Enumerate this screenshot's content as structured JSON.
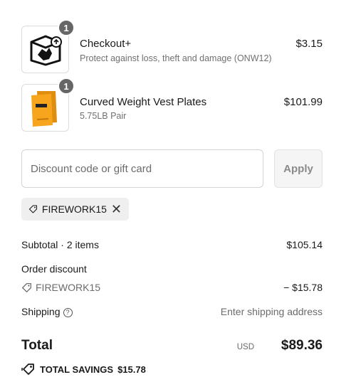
{
  "items": [
    {
      "name": "Checkout+",
      "subtitle": "Protect against loss, theft and damage (ONW12)",
      "price": "$3.15",
      "quantity": "1",
      "icon": "package-shield-icon"
    },
    {
      "name": "Curved Weight Vest Plates",
      "subtitle": "5.75LB Pair",
      "price": "$101.99",
      "quantity": "1",
      "icon": "weight-plate-image"
    }
  ],
  "discount": {
    "placeholder": "Discount code or gift card",
    "apply_label": "Apply",
    "applied_code": "FIREWORK15"
  },
  "summary": {
    "subtotal_label": "Subtotal · 2 items",
    "subtotal_value": "$105.14",
    "order_discount_label": "Order discount",
    "discount_code": "FIREWORK15",
    "discount_value": "− $15.78",
    "shipping_label": "Shipping",
    "shipping_value": "Enter shipping address"
  },
  "total": {
    "label": "Total",
    "currency": "USD",
    "amount": "$89.36",
    "savings_label": "TOTAL SAVINGS",
    "savings_value": "$15.78"
  },
  "colors": {
    "badge": "#666666",
    "product_orange": "#f7a51c",
    "chip_bg": "#efefef"
  }
}
